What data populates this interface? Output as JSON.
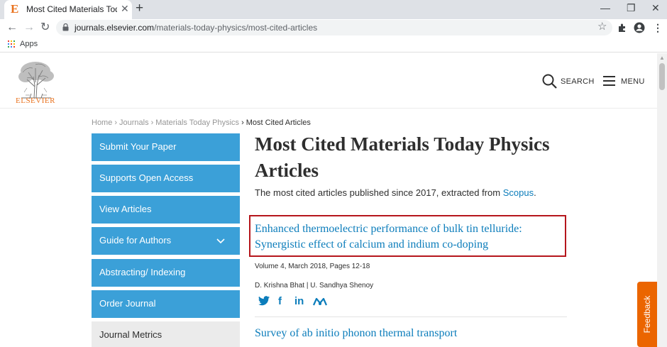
{
  "browser": {
    "tab_title": "Most Cited Materials Today Physics",
    "tab_favicon": "E",
    "url_domain": "journals.elsevier.com",
    "url_path": "/materials-today-physics/most-cited-articles",
    "bookmarks_apps_label": "Apps"
  },
  "header": {
    "logo_text": "ELSEVIER",
    "search_label": "SEARCH",
    "menu_label": "MENU"
  },
  "breadcrumb": {
    "items": [
      "Home",
      "Journals",
      "Materials Today Physics"
    ],
    "current": "Most Cited Articles"
  },
  "sidebar": {
    "items": [
      {
        "label": "Submit Your Paper"
      },
      {
        "label": "Supports Open Access"
      },
      {
        "label": "View Articles"
      },
      {
        "label": "Guide for Authors"
      },
      {
        "label": "Abstracting/ Indexing"
      },
      {
        "label": "Order Journal"
      },
      {
        "label": "Journal Metrics"
      }
    ]
  },
  "main": {
    "title": "Most Cited Materials Today Physics Articles",
    "subtitle_prefix": "The most cited articles published since 2017, extracted from ",
    "subtitle_link": "Scopus",
    "subtitle_suffix": ".",
    "articles": [
      {
        "title_line1": "Enhanced thermoelectric performance of bulk tin telluride:",
        "title_line2": "Synergistic effect of calcium and indium co-doping",
        "volume": "Volume 4, March 2018, Pages 12-18",
        "authors": "D. Krishna Bhat | U. Sandhya Shenoy"
      },
      {
        "title_line1": "Survey of ab initio phonon thermal transport"
      }
    ]
  },
  "feedback_label": "Feedback",
  "colors": {
    "sidebar_blue": "#3ba0d8",
    "link_blue": "#0c7dbb",
    "elsevier_orange": "#e9711c",
    "highlight_red": "#b5161c",
    "feedback_orange": "#eb6500"
  }
}
